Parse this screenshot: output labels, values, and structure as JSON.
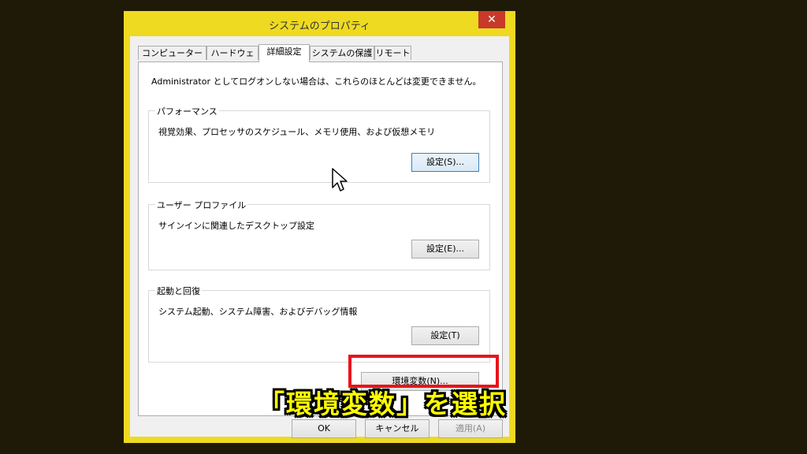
{
  "window": {
    "title": "システムのプロパティ",
    "close_label": "✕"
  },
  "tabs": [
    {
      "label": "コンピューター名"
    },
    {
      "label": "ハードウェア"
    },
    {
      "label": "詳細設定",
      "active": true
    },
    {
      "label": "システムの保護"
    },
    {
      "label": "リモート"
    }
  ],
  "panel": {
    "note": "Administrator としてログオンしない場合は、これらのほとんどは変更できません。",
    "groups": [
      {
        "label": "パフォーマンス",
        "desc": "視覚効果、プロセッサのスケジュール、メモリ使用、および仮想メモリ",
        "button": "設定(S)..."
      },
      {
        "label": "ユーザー プロファイル",
        "desc": "サインインに関連したデスクトップ設定",
        "button": "設定(E)..."
      },
      {
        "label": "起動と回復",
        "desc": "システム起動、システム障害、およびデバッグ情報",
        "button": "設定(T)"
      }
    ],
    "env_button": "環境変数(N)..."
  },
  "footer": {
    "ok": "OK",
    "cancel": "キャンセル",
    "apply": "適用(A)"
  },
  "caption": "「環境変数」を選択",
  "colors": {
    "background": "#1f1a07",
    "window_frame": "#eeda21",
    "highlight": "#e8141b",
    "caption_text": "#ffff00"
  }
}
